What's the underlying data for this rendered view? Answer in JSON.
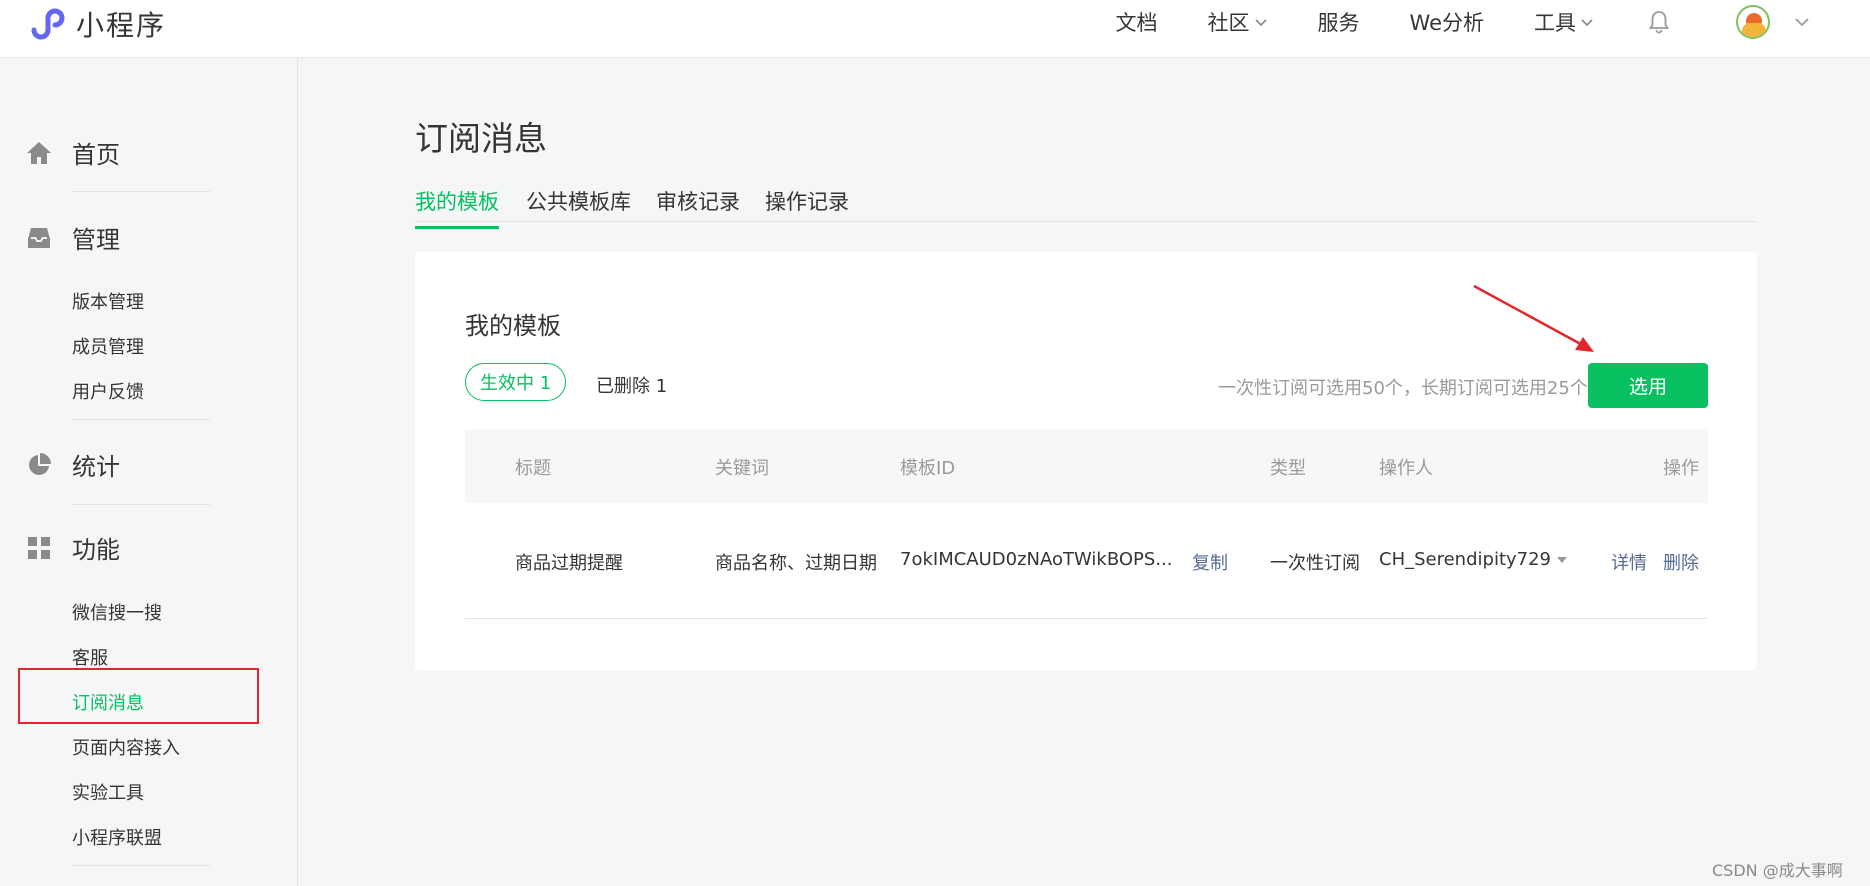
{
  "header": {
    "logo_text": "小程序",
    "nav": [
      {
        "label": "文档",
        "has_dropdown": false
      },
      {
        "label": "社区",
        "has_dropdown": true
      },
      {
        "label": "服务",
        "has_dropdown": false
      },
      {
        "label": "We分析",
        "has_dropdown": false
      },
      {
        "label": "工具",
        "has_dropdown": true
      }
    ],
    "icons": {
      "bell": "bell-icon",
      "avatar": "user-avatar"
    }
  },
  "sidebar": {
    "home": "首页",
    "manage": "管理",
    "manage_items": [
      "版本管理",
      "成员管理",
      "用户反馈"
    ],
    "stats": "统计",
    "features": "功能",
    "feature_items": [
      "微信搜一搜",
      "客服",
      "订阅消息",
      "页面内容接入",
      "实验工具",
      "小程序联盟"
    ],
    "active_item": "订阅消息"
  },
  "main": {
    "title": "订阅消息",
    "tabs": [
      "我的模板",
      "公共模板库",
      "审核记录",
      "操作记录"
    ],
    "active_tab": "我的模板",
    "card": {
      "title": "我的模板",
      "filter_active": "生效中  1",
      "filter_deleted": "已删除  1",
      "hint": "一次性订阅可选用50个，长期订阅可选用25个",
      "select_button": "选用",
      "columns": [
        "标题",
        "关键词",
        "模板ID",
        "类型",
        "操作人",
        "操作"
      ],
      "rows": [
        {
          "title": "商品过期提醒",
          "keywords": "商品名称、过期日期",
          "template_id": "7okIMCAUD0zNAoTWikBOPS...",
          "copy": "复制",
          "type": "一次性订阅",
          "operator": "CH_Serendipity729",
          "detail": "详情",
          "delete": "删除"
        }
      ]
    }
  },
  "watermark": "CSDN @成大事啊",
  "colors": {
    "accent": "#07c160",
    "link": "#576b95",
    "annotation": "#e3262c"
  }
}
